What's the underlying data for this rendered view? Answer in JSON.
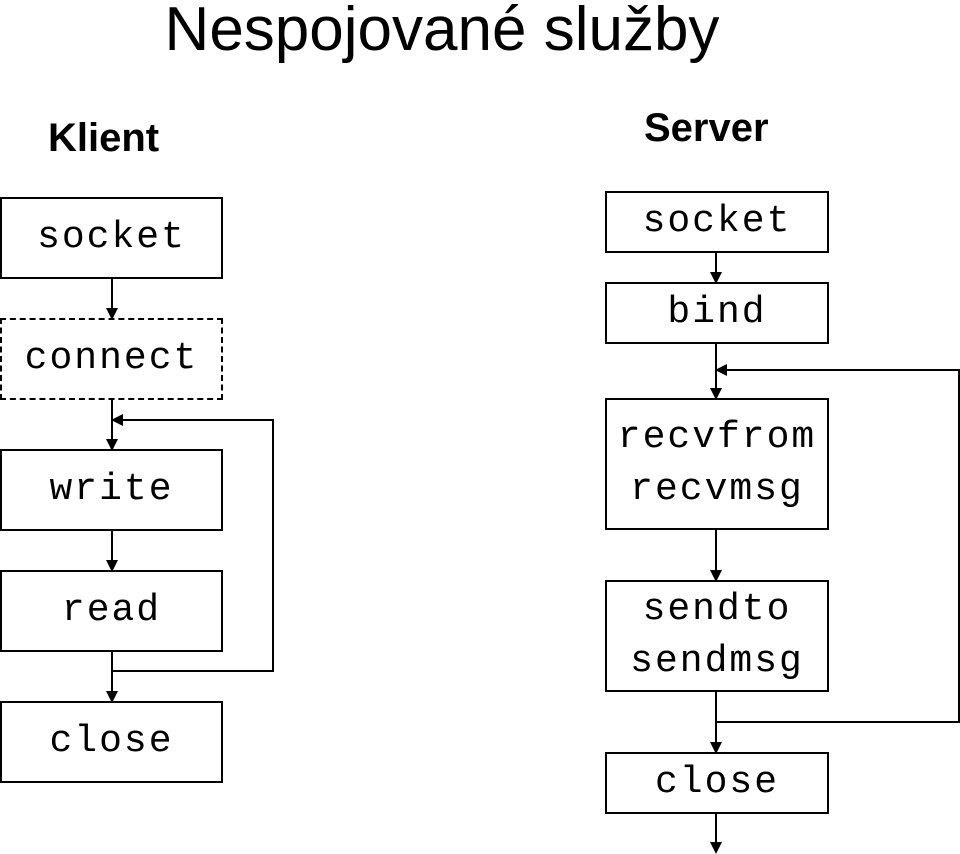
{
  "title": "Nespojované služby",
  "client": {
    "heading": "Klient",
    "steps": [
      {
        "lines": [
          "socket"
        ],
        "style": "solid"
      },
      {
        "lines": [
          "connect"
        ],
        "style": "dashed"
      },
      {
        "lines": [
          "write"
        ],
        "style": "solid"
      },
      {
        "lines": [
          "read"
        ],
        "style": "solid"
      },
      {
        "lines": [
          "close"
        ],
        "style": "solid"
      }
    ],
    "loop": {
      "from": "read",
      "to": "write"
    }
  },
  "server": {
    "heading": "Server",
    "steps": [
      {
        "lines": [
          "socket"
        ],
        "style": "solid"
      },
      {
        "lines": [
          "bind"
        ],
        "style": "solid"
      },
      {
        "lines": [
          "recvfrom",
          "recvmsg"
        ],
        "style": "solid"
      },
      {
        "lines": [
          "sendto",
          "sendmsg"
        ],
        "style": "solid"
      },
      {
        "lines": [
          "close"
        ],
        "style": "solid"
      }
    ],
    "loop": {
      "from": "sendto/sendmsg",
      "to": "recvfrom/recvmsg"
    }
  }
}
